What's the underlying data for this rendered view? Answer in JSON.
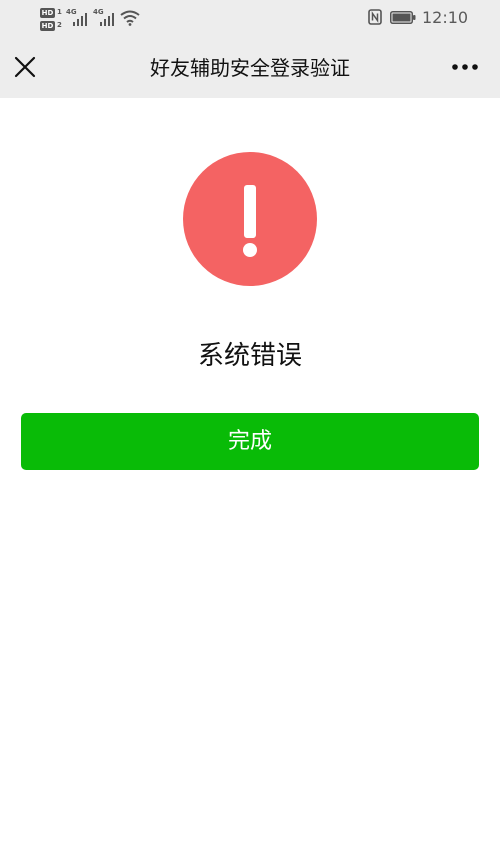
{
  "status_bar": {
    "hd_badge_1": "HD",
    "hd_badge_2": "HD",
    "hd_sub_1": "1",
    "hd_sub_2": "2",
    "network_1": "4G",
    "network_2": "4G",
    "time": "12:10",
    "icons": [
      "hd-icon",
      "signal-icon",
      "wifi-icon",
      "nfc-icon",
      "battery-icon"
    ]
  },
  "nav": {
    "title": "好友辅助安全登录验证",
    "close_icon": "close-icon",
    "more_icon": "more-icon"
  },
  "main": {
    "alert_icon": "exclamation-icon",
    "error_text": "系统错误",
    "done_label": "完成"
  },
  "colors": {
    "nav_background": "#ededed",
    "alert_red": "#f46363",
    "button_green": "#09bb07",
    "page_background": "#ffffff"
  }
}
